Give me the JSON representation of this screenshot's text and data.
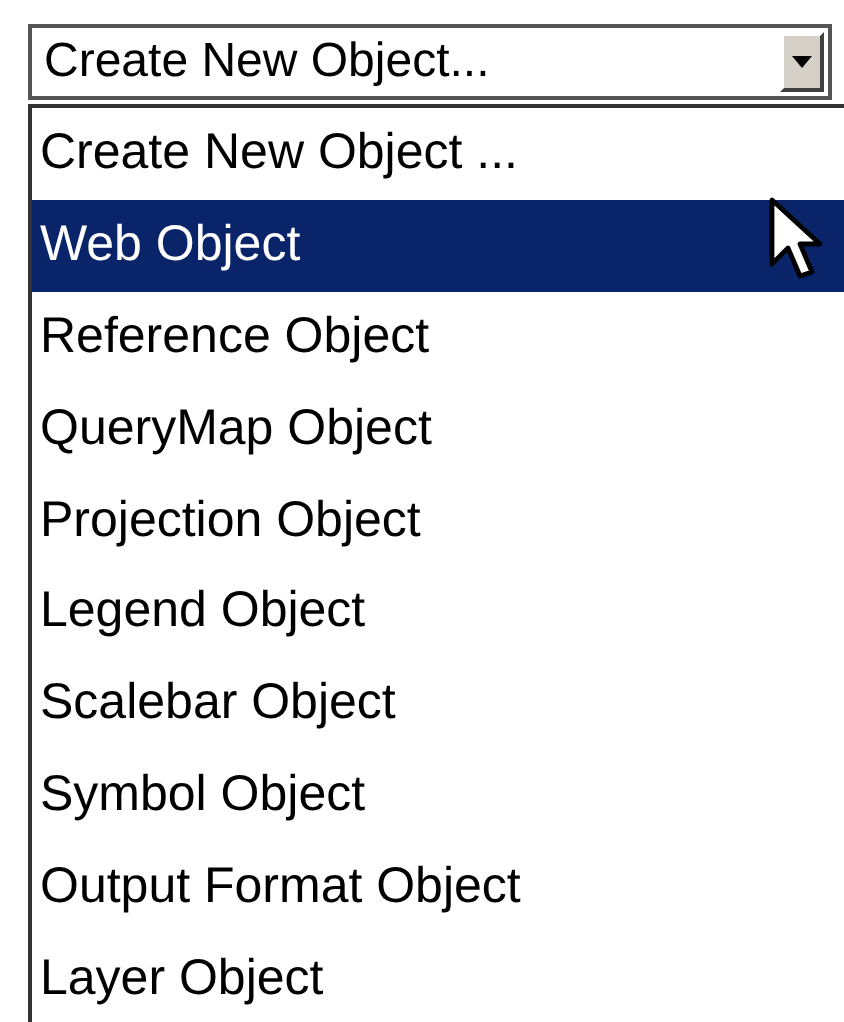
{
  "select": {
    "value": "Create New Object..."
  },
  "options": [
    {
      "label": "Create New Object ...",
      "selected": false
    },
    {
      "label": "Web Object",
      "selected": true
    },
    {
      "label": "Reference Object",
      "selected": false
    },
    {
      "label": "QueryMap Object",
      "selected": false
    },
    {
      "label": "Projection Object",
      "selected": false
    },
    {
      "label": "Legend Object",
      "selected": false
    },
    {
      "label": "Scalebar Object",
      "selected": false
    },
    {
      "label": "Symbol Object",
      "selected": false
    },
    {
      "label": "Output Format Object",
      "selected": false
    },
    {
      "label": "Layer Object",
      "selected": false
    }
  ]
}
